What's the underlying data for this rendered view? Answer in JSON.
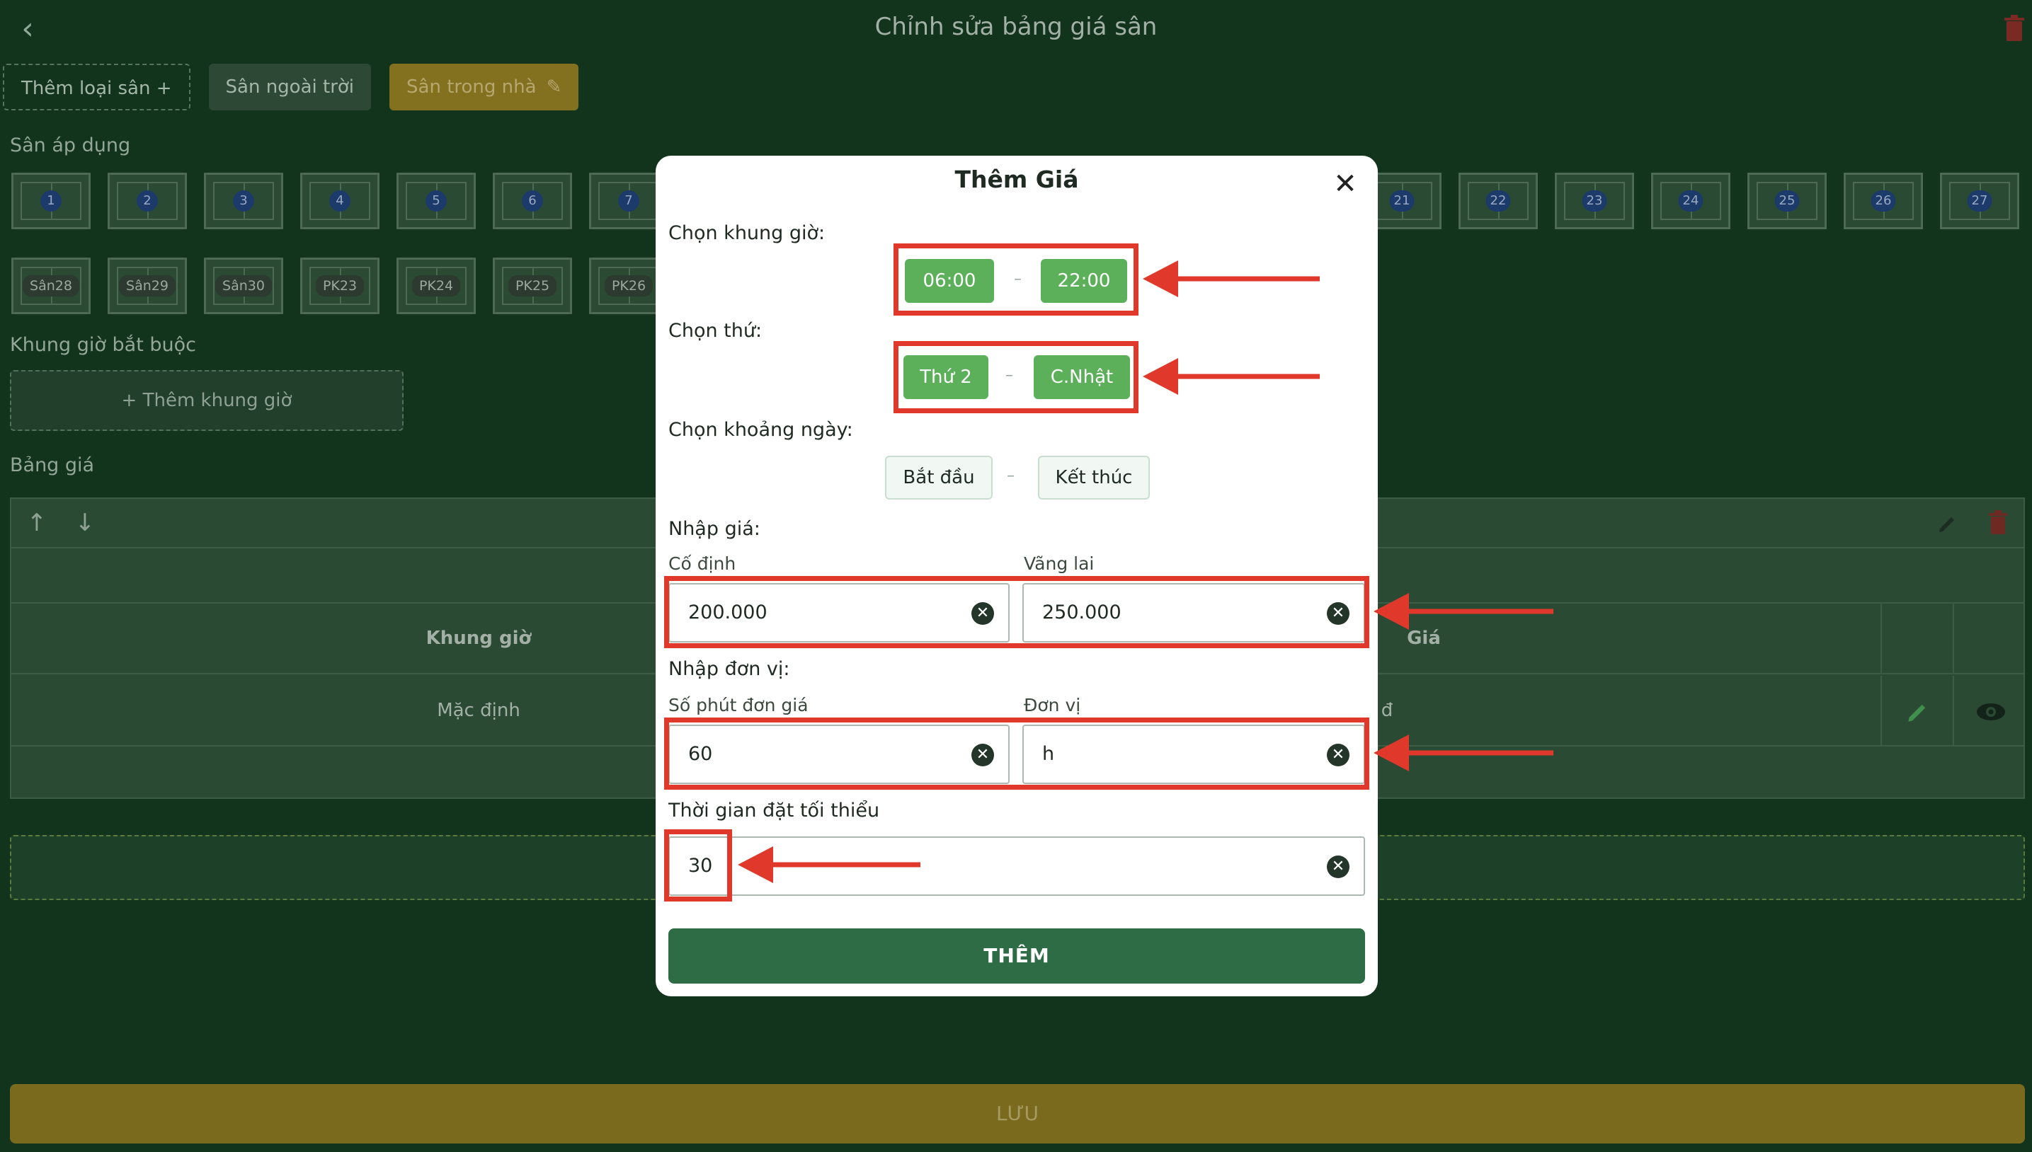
{
  "header": {
    "title": "Chỉnh sửa bảng giá sân",
    "back_icon": "‹"
  },
  "type_tabs": {
    "add_label": "Thêm loại sân +",
    "outdoor_label": "Sân ngoài trời",
    "indoor_label": "Sân trong nhà",
    "edit_icon": "✎"
  },
  "sections": {
    "courts_label": "Sân áp dụng",
    "required_time_label": "Khung giờ bắt buộc",
    "add_time_label": "+ Thêm khung giờ",
    "price_table_label": "Bảng giá"
  },
  "courts_row1": [
    "1",
    "2",
    "3",
    "4",
    "5",
    "6",
    "7",
    "21",
    "22",
    "23",
    "24",
    "25",
    "26",
    "27"
  ],
  "courts_row2": [
    "Sân28",
    "Sân29",
    "Sân30",
    "PK23",
    "PK24",
    "PK25",
    "PK26"
  ],
  "price_table": {
    "up_icon": "↑",
    "down_icon": "↓",
    "col_time": "Khung giờ",
    "col_price": "Giá",
    "row_time": "Mặc định",
    "row_price": "0 đ"
  },
  "save_label": "LƯU",
  "modal": {
    "title": "Thêm Giá",
    "close_icon": "✕",
    "time_label": "Chọn khung giờ:",
    "time_start": "06:00",
    "time_end": "22:00",
    "day_label": "Chọn thứ:",
    "day_start": "Thứ 2",
    "day_end": "C.Nhật",
    "date_label": "Chọn khoảng ngày:",
    "date_start": "Bắt đầu",
    "date_end": "Kết thúc",
    "price_label": "Nhập giá:",
    "fixed_label": "Cố định",
    "fixed_value": "200.000",
    "walkin_label": "Vãng lai",
    "walkin_value": "250.000",
    "unit_label": "Nhập đơn vị:",
    "minutes_label": "Số phút đơn giá",
    "minutes_value": "60",
    "unit_sublabel": "Đơn vị",
    "unit_value": "h",
    "min_time_label": "Thời gian đặt tối thiểu",
    "min_time_value": "30",
    "submit_label": "THÊM",
    "separator": "–",
    "clear_icon": "✕"
  },
  "colors": {
    "accent_green": "#5db05a",
    "submit_green": "#2e6c45",
    "annotation_red": "#e0392c"
  }
}
